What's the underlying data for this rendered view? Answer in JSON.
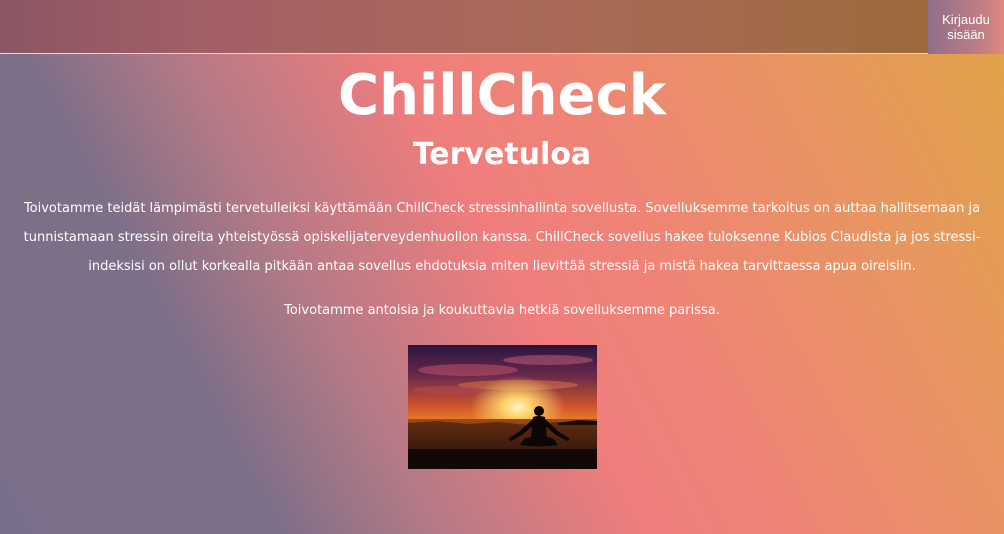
{
  "header": {
    "login_label_line1": "Kirjaudu",
    "login_label_line2": "sisään"
  },
  "main": {
    "title": "ChillCheck",
    "subtitle": "Tervetuloa",
    "intro_text": "Toivotamme teidät lämpimästi tervetulleiksi käyttämään ChillCheck stressinhallinta sovellusta. Sovelluksemme tarkoitus on auttaa hallitsemaan ja tunnistamaan stressin oireita yhteistyössä opiskelijaterveydenhuollon kanssa. ChillCheck sovellus hakee tuloksenne Kubios Claudista ja jos stressi-indeksisi on ollut korkealla pitkään antaa sovellus ehdotuksia miten lievittää stressiä ja mistä hakea tarvittaessa apua oireisiin.",
    "closing_text": "Toivotamme antoisia ja koukuttavia hetkiä sovelluksemme parissa."
  },
  "colors": {
    "background_gradient": [
      "#7a6f8a",
      "#ef7d7d",
      "#e0a445"
    ],
    "text": "#ffffff"
  }
}
